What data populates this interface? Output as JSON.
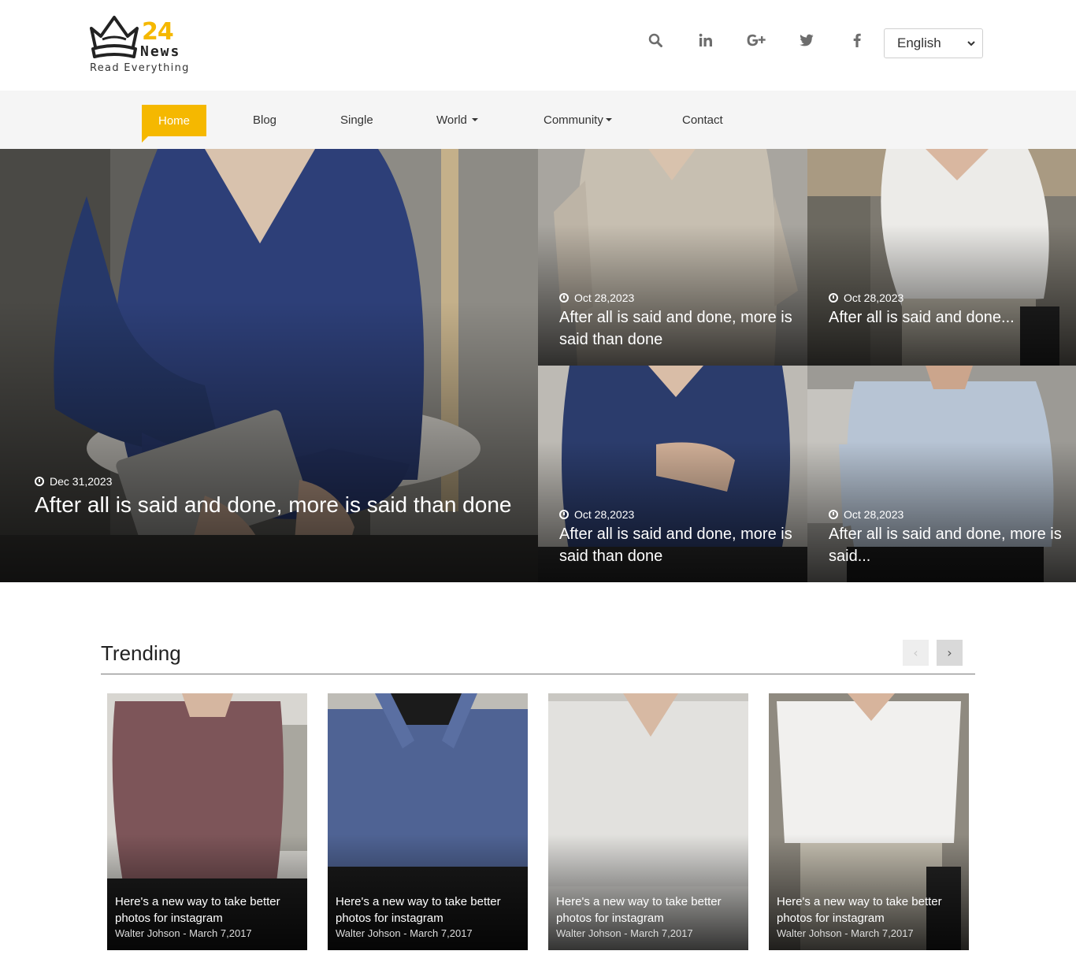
{
  "brand": {
    "number": "24",
    "name": "News",
    "tagline": "Read Everything"
  },
  "social": [
    {
      "icon": "search-icon",
      "glyph": "search"
    },
    {
      "icon": "linkedin-icon",
      "glyph": "in"
    },
    {
      "icon": "google-plus-icon",
      "glyph": "G+"
    },
    {
      "icon": "twitter-icon",
      "glyph": "twitter"
    },
    {
      "icon": "facebook-icon",
      "glyph": "f"
    }
  ],
  "language": {
    "selected": "English"
  },
  "nav": {
    "home": "Home",
    "blog": "Blog",
    "single": "Single",
    "world": "World",
    "community": "Community",
    "contact": "Contact"
  },
  "hero": {
    "main": {
      "date": "Dec 31,2023",
      "title": "After all is said and done, more is said than done"
    },
    "tiles": [
      {
        "date": "Oct 28,2023",
        "title": "After all is said and done, more is said than done"
      },
      {
        "date": "Oct 28,2023",
        "title": "After all is said and done..."
      },
      {
        "date": "Oct 28,2023",
        "title": "After all is said and done, more is said than done"
      },
      {
        "date": "Oct 28,2023",
        "title": "After all is said and done, more is said..."
      }
    ]
  },
  "trending": {
    "heading": "Trending",
    "prev": "‹",
    "next": "›",
    "cards": [
      {
        "title": "Here's a new way to take better photos for instagram",
        "meta": "Walter Johson - March 7,2017"
      },
      {
        "title": "Here's a new way to take better photos for instagram",
        "meta": "Walter Johson - March 7,2017"
      },
      {
        "title": "Here's a new way to take better photos for instagram",
        "meta": "Walter Johson - March 7,2017"
      },
      {
        "title": "Here's a new way to take better photos for instagram",
        "meta": "Walter Johson - March 7,2017"
      }
    ]
  },
  "colors": {
    "accent": "#f5b800",
    "nav_bg": "#f5f5f5"
  }
}
